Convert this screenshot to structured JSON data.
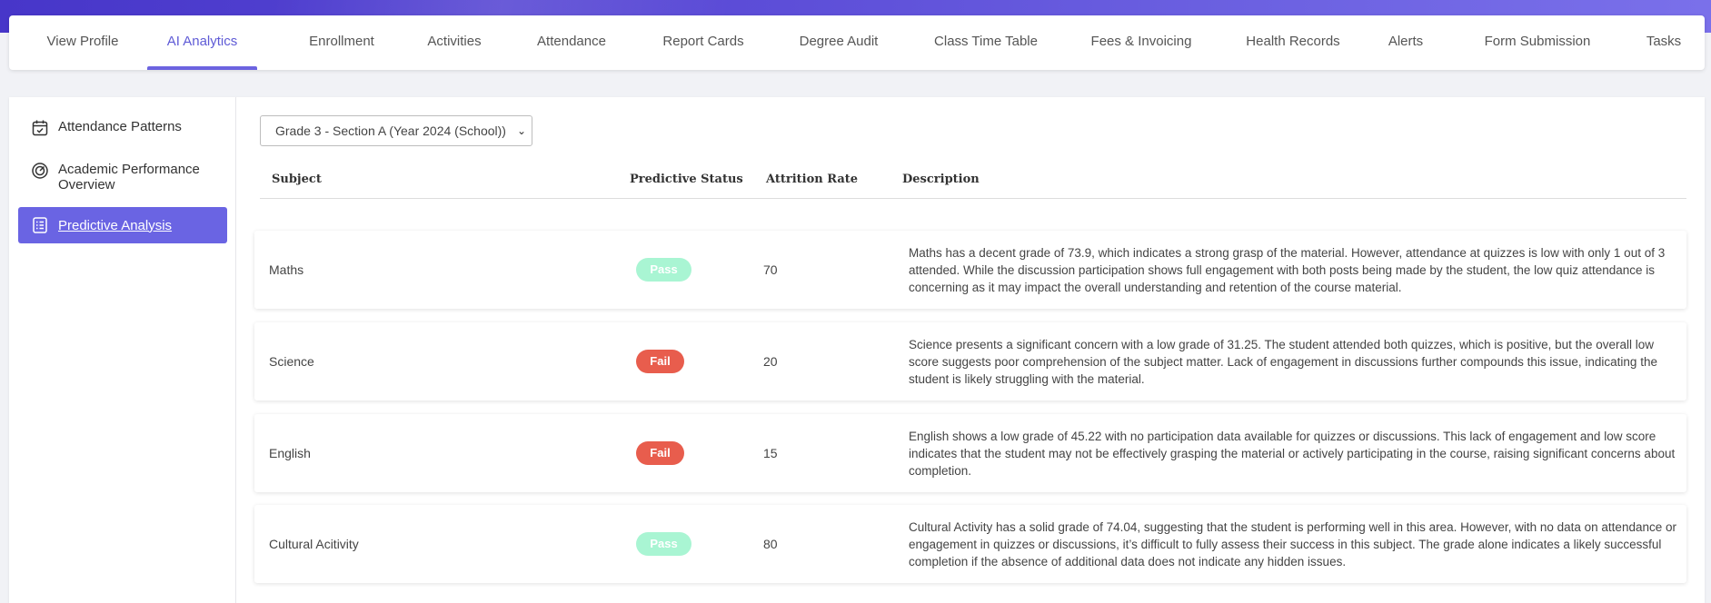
{
  "top_tabs": [
    "View Profile",
    "AI Analytics",
    "Enrollment",
    "Activities",
    "Attendance",
    "Report Cards",
    "Degree Audit",
    "Class Time Table",
    "Fees & Invoicing",
    "Health Records",
    "Alerts",
    "Form Submission",
    "Tasks"
  ],
  "active_tab": "AI Analytics",
  "sidebar": {
    "items": [
      {
        "label": "Attendance Patterns",
        "icon": "calendar-check-icon"
      },
      {
        "label": "Academic Performance Overview",
        "icon": "gauge-icon"
      },
      {
        "label": "Predictive Analysis",
        "icon": "list-icon"
      }
    ],
    "active": "Predictive Analysis"
  },
  "class_select": {
    "value": "Grade 3 - Section A (Year 2024 (School))"
  },
  "table": {
    "headers": {
      "subject": "Subject",
      "status": "Predictive Status",
      "rate": "Attrition Rate",
      "description": "Description"
    },
    "rows": [
      {
        "subject": "Maths",
        "status": "Pass",
        "rate": "70",
        "description": "Maths has a decent grade of 73.9, which indicates a strong grasp of the material. However, attendance at quizzes is low with only 1 out of 3 attended. While the discussion participation shows full engagement with both posts being made by the student, the low quiz attendance is concerning as it may impact the overall understanding and retention of the course material."
      },
      {
        "subject": "Science",
        "status": "Fail",
        "rate": "20",
        "description": "Science presents a significant concern with a low grade of 31.25. The student attended both quizzes, which is positive, but the overall low score suggests poor comprehension of the subject matter. Lack of engagement in discussions further compounds this issue, indicating the student is likely struggling with the material."
      },
      {
        "subject": "English",
        "status": "Fail",
        "rate": "15",
        "description": "English shows a low grade of 45.22 with no participation data available for quizzes or discussions. This lack of engagement and low score indicates that the student may not be effectively grasping the material or actively participating in the course, raising significant concerns about completion."
      },
      {
        "subject": "Cultural Acitivity",
        "status": "Pass",
        "rate": "80",
        "description": "Cultural Activity has a solid grade of 74.04, suggesting that the student is performing well in this area. However, with no data on attendance or engagement in quizzes or discussions, it’s difficult to fully assess their success in this subject. The grade alone indicates a likely successful completion if the absence of additional data does not indicate any hidden issues."
      }
    ]
  },
  "colors": {
    "accent": "#6a64e3",
    "pass": "#a9f5d3",
    "fail": "#e85d4d"
  }
}
